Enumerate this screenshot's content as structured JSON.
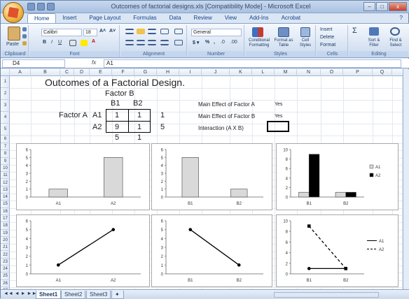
{
  "window": {
    "title": "Outcomes of factorial designs.xls [Compatibility Mode] - Microsoft Excel",
    "controls": {
      "minimize": "–",
      "maximize": "□",
      "close": "x"
    }
  },
  "ribbon": {
    "tabs": [
      "Home",
      "Insert",
      "Page Layout",
      "Formulas",
      "Data",
      "Review",
      "View",
      "Add-Ins",
      "Acrobat"
    ],
    "active_tab": "Home",
    "groups": {
      "clipboard": {
        "label": "Clipboard",
        "paste": "Paste"
      },
      "font": {
        "label": "Font",
        "font_name": "Calibri",
        "font_size": "18"
      },
      "alignment": {
        "label": "Alignment"
      },
      "number": {
        "label": "Number",
        "format": "General"
      },
      "styles": {
        "label": "Styles",
        "conditional": "Conditional Formatting",
        "format_table": "Format as Table",
        "cell_styles": "Cell Styles"
      },
      "cells": {
        "label": "Cells",
        "insert": "Insert",
        "delete": "Delete",
        "format": "Format"
      },
      "editing": {
        "label": "Editing",
        "sort": "Sort & Filter",
        "find": "Find & Select"
      }
    }
  },
  "formula_bar": {
    "name_box": "D4",
    "fx": "fx",
    "value": "A1"
  },
  "columns": [
    "A",
    "B",
    "C",
    "D",
    "E",
    "F",
    "G",
    "H",
    "I",
    "J",
    "K",
    "L",
    "M",
    "N",
    "O",
    "P",
    "Q"
  ],
  "rows": [
    "1",
    "2",
    "3",
    "4",
    "5",
    "6",
    "7",
    "8",
    "9",
    "10",
    "11",
    "12",
    "13",
    "14",
    "15",
    "16",
    "17",
    "18",
    "19",
    "20",
    "21",
    "22",
    "23",
    "24",
    "25",
    "26",
    "27"
  ],
  "cells": {
    "title": "Outcomes of a Factorial Design.",
    "factor_b": "Factor B",
    "b1": "B1",
    "b2": "B2",
    "factor_a": "Factor A",
    "a1": "A1",
    "a2": "A2",
    "a1b1": "1",
    "a1b2": "1",
    "a2b1": "9",
    "a2b2": "1",
    "row_mean_a1": "1",
    "row_mean_a2": "5",
    "col_mean_b1": "5",
    "col_mean_b2": "1",
    "main_effect_a_label": "Main Effect of Factor A",
    "main_effect_a_value": "Yes",
    "main_effect_b_label": "Main Effect of Factor B",
    "main_effect_b_value": "Yes",
    "interaction_label": "Interaction (A X B)",
    "interaction_value": ""
  },
  "sheets": {
    "tabs": [
      "Sheet1",
      "Sheet2",
      "Sheet3"
    ],
    "active": "Sheet1"
  },
  "chart_data": [
    {
      "type": "bar",
      "categories": [
        "A1",
        "A2"
      ],
      "values": [
        1,
        5
      ],
      "ylim": [
        0,
        6
      ],
      "yticks": [
        0,
        1,
        2,
        3,
        4,
        5,
        6
      ],
      "color": "#d9d9d9"
    },
    {
      "type": "bar",
      "categories": [
        "B1",
        "B2"
      ],
      "values": [
        5,
        1
      ],
      "ylim": [
        0,
        6
      ],
      "yticks": [
        0,
        1,
        2,
        3,
        4,
        5,
        6
      ],
      "color": "#d9d9d9"
    },
    {
      "type": "bar",
      "categories": [
        "B1",
        "B2"
      ],
      "series": [
        {
          "name": "A1",
          "values": [
            1,
            1
          ],
          "color": "#d9d9d9"
        },
        {
          "name": "A2",
          "values": [
            9,
            1
          ],
          "color": "#000000"
        }
      ],
      "ylim": [
        0,
        10
      ],
      "yticks": [
        0,
        2,
        4,
        6,
        8,
        10
      ],
      "legend": "right"
    },
    {
      "type": "line",
      "categories": [
        "A1",
        "A2"
      ],
      "values": [
        1,
        5
      ],
      "ylim": [
        0,
        6
      ],
      "yticks": [
        0,
        1,
        2,
        3,
        4,
        5,
        6
      ]
    },
    {
      "type": "line",
      "categories": [
        "B1",
        "B2"
      ],
      "values": [
        5,
        1
      ],
      "ylim": [
        0,
        6
      ],
      "yticks": [
        0,
        1,
        2,
        3,
        4,
        5,
        6
      ]
    },
    {
      "type": "line",
      "categories": [
        "B1",
        "B2"
      ],
      "series": [
        {
          "name": "A1",
          "values": [
            1,
            1
          ],
          "dash": "solid"
        },
        {
          "name": "A2",
          "values": [
            9,
            1
          ],
          "dash": "dashed"
        }
      ],
      "ylim": [
        0,
        10
      ],
      "yticks": [
        0,
        2,
        4,
        6,
        8,
        10
      ],
      "legend": "right"
    }
  ]
}
